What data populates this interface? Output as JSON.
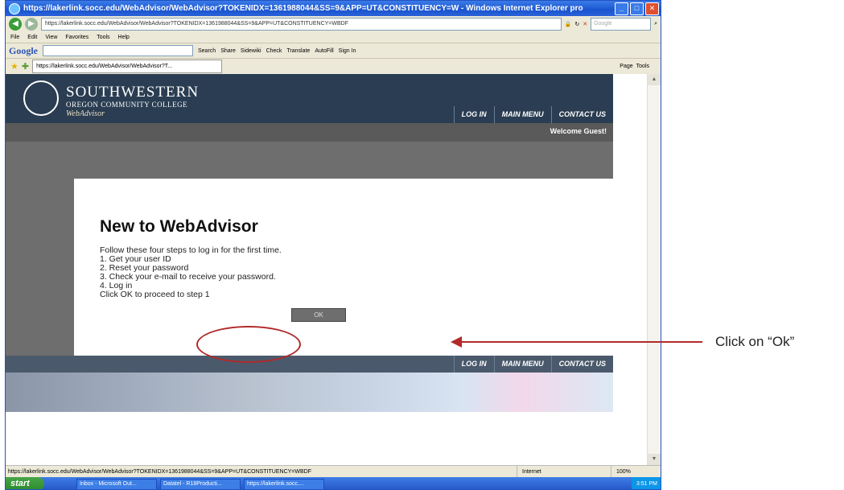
{
  "browser": {
    "title": "https://lakerlink.socc.edu/WebAdvisor/WebAdvisor?TOKENIDX=1361988044&SS=9&APP=UT&CONSTITUENCY=W - Windows Internet Explorer pro",
    "url": "https://lakerlink.socc.edu/WebAdvisor/WebAdvisor?TOKENIDX=1361988044&SS=9&APP=UT&CONSTITUENCY=WBDF",
    "search_placeholder": "Google",
    "menu": [
      "File",
      "Edit",
      "View",
      "Favorites",
      "Tools",
      "Help"
    ],
    "google_toolbar": {
      "logo": "Google",
      "items": [
        "Search",
        "Share",
        "Sidewiki",
        "Check",
        "Translate",
        "AutoFill",
        "Sign In"
      ]
    },
    "tab_title": "https://lakerlink.socc.edu/WebAdvisor/WebAdvisor?T...",
    "command_bar": [
      "Page",
      "Tools"
    ],
    "status_url": "https://lakerlink.socc.edu/WebAdvisor/WebAdvisor?TOKENIDX=1361988044&SS=9&APP=UT&CONSTITUENCY=WBDF",
    "status_zone": "Internet",
    "status_zoom": "100%"
  },
  "site": {
    "logo_line1": "SOUTHWESTERN",
    "logo_line2": "OREGON COMMUNITY COLLEGE",
    "logo_line3": "WebAdvisor",
    "nav": [
      "LOG IN",
      "MAIN MENU",
      "CONTACT US"
    ],
    "welcome": "Welcome Guest!"
  },
  "panel": {
    "title": "New to WebAdvisor",
    "lines": [
      "Follow these four steps to log in for the first time.",
      "1. Get your user ID",
      "2. Reset your password",
      "3. Check your e-mail to receive your password.",
      "4. Log in",
      "Click OK to proceed to step 1"
    ],
    "ok_label": "OK"
  },
  "taskbar": {
    "start": "start",
    "items": [
      "Inbox - Microsoft Out...",
      "Datatel - R18Producti...",
      "https://lakerlink.socc...."
    ],
    "clock": "3:51 PM"
  },
  "annotation": {
    "callout": "Click on “Ok”",
    "color": "#b22a2a"
  }
}
